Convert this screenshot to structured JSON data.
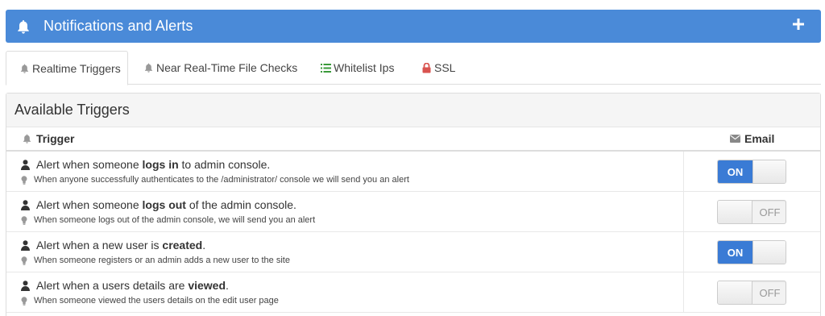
{
  "header": {
    "title": "Notifications and Alerts"
  },
  "tabs": [
    {
      "label": "Realtime Triggers",
      "icon": "bell-icon"
    },
    {
      "label": "Near Real-Time File Checks",
      "icon": "bell-icon"
    },
    {
      "label": "Whitelist Ips",
      "icon": "list-icon"
    },
    {
      "label": "SSL",
      "icon": "lock-icon"
    }
  ],
  "panel": {
    "title": "Available Triggers",
    "col_trigger": "Trigger",
    "col_email": "Email"
  },
  "triggers": [
    {
      "pre": "Alert when someone ",
      "bold": "logs in",
      "post": " to admin console.",
      "desc": "When anyone successfully authenticates to the /administrator/ console we will send you an alert",
      "email": true
    },
    {
      "pre": "Alert when someone ",
      "bold": "logs out",
      "post": " of the admin console.",
      "desc": "When someone logs out of the admin console, we will send you an alert",
      "email": false
    },
    {
      "pre": "Alert when a new user is ",
      "bold": "created",
      "post": ".",
      "desc": "When someone registers or an admin adds a new user to the site",
      "email": true
    },
    {
      "pre": "Alert when a users details are ",
      "bold": "viewed",
      "post": ".",
      "desc": "When someone viewed the users details on the edit user page",
      "email": false
    }
  ],
  "toggle": {
    "on_label": "ON",
    "off_label": "OFF"
  },
  "colors": {
    "header": "#4a8ad8",
    "toggle_on": "#3a7bd5",
    "ssl_lock": "#d9534f",
    "list": "#3a9a3a"
  }
}
